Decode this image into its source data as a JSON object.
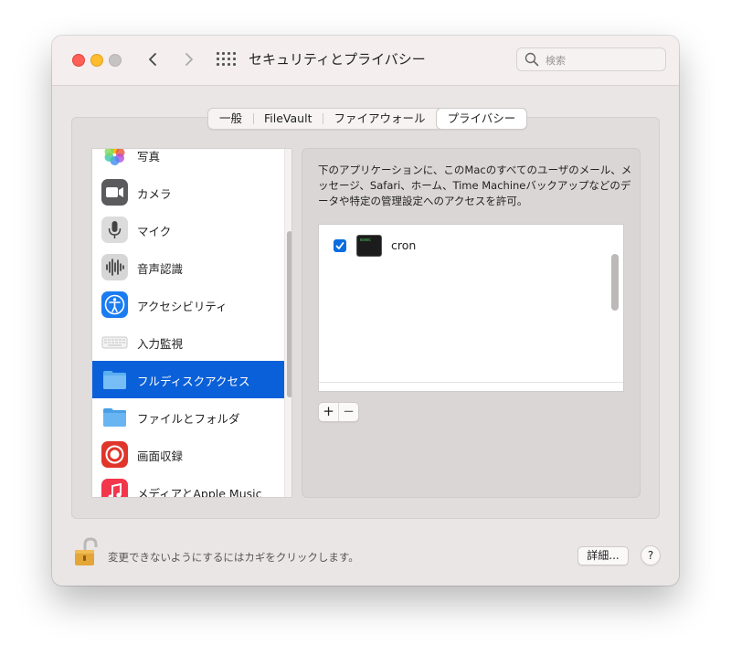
{
  "window": {
    "title": "セキュリティとプライバシー",
    "search_placeholder": "検索"
  },
  "tabs": [
    {
      "label": "一般",
      "active": false
    },
    {
      "label": "FileVault",
      "active": false
    },
    {
      "label": "ファイアウォール",
      "active": false
    },
    {
      "label": "プライバシー",
      "active": true
    }
  ],
  "sidebar": {
    "items": [
      {
        "label": "写真",
        "icon": "photos-icon"
      },
      {
        "label": "カメラ",
        "icon": "camera-icon"
      },
      {
        "label": "マイク",
        "icon": "microphone-icon"
      },
      {
        "label": "音声認識",
        "icon": "speech-recognition-icon"
      },
      {
        "label": "アクセシビリティ",
        "icon": "accessibility-icon"
      },
      {
        "label": "入力監視",
        "icon": "keyboard-icon"
      },
      {
        "label": "フルディスクアクセス",
        "icon": "folder-icon",
        "selected": true
      },
      {
        "label": "ファイルとフォルダ",
        "icon": "folder-icon"
      },
      {
        "label": "画面収録",
        "icon": "screen-recording-icon"
      },
      {
        "label": "メディアとApple Music",
        "icon": "music-icon"
      }
    ]
  },
  "detail": {
    "description": "下のアプリケーションに、このMacのすべてのユーザのメール、メッセージ、Safari、ホーム、Time Machineバックアップなどのデータや特定の管理設定へのアクセスを許可。",
    "apps": [
      {
        "name": "cron",
        "checked": true,
        "icon": "terminal-exec-icon"
      }
    ],
    "add_label": "+",
    "remove_label": "−"
  },
  "footer": {
    "lock_text": "変更できないようにするにはカギをクリックします。",
    "details_label": "詳細...",
    "help_label": "?"
  },
  "colors": {
    "accent": "#0a60d8",
    "close": "#fe5f57",
    "minimize": "#febc2e"
  }
}
